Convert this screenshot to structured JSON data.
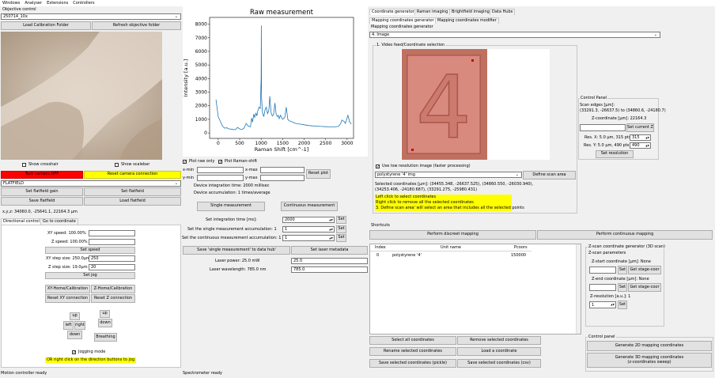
{
  "menu": [
    "Windows",
    "Analyser",
    "Extensions",
    "Controllers"
  ],
  "objective": {
    "group_label": "Objective control",
    "selected": "250714_10x",
    "load_calib": "Load Calibration Folder",
    "refresh": "Refresh objective folder",
    "show_crosshair": "Show crosshair",
    "show_scalebar": "Show scalebar",
    "turn_camera_off": "Turn camera OFF",
    "reset_camera": "Reset camera connection",
    "flatfield_select": "FLATFIELD",
    "set_flatfield_gain": "Set flatfield gain",
    "set_flatfield": "Set flatfield",
    "save_flatfield": "Save flatfield",
    "load_flatfield": "Load flatfield",
    "coords": "x,y,z: 34060.0, -25641.1, 22164.3 µm"
  },
  "motion": {
    "tab_directional": "Directional control",
    "tab_goto": "Go to coordinate",
    "xy_speed_label": "XY speed: 100.00%",
    "z_speed_label": "Z speed: 100.00%",
    "set_speed": "Set speed",
    "xy_step_label": "XY step size: 250.0µm",
    "xy_step_value": "250",
    "z_step_label": "Z step size: 19.0µm",
    "z_step_value": "20",
    "set_jog": "Set jog",
    "xy_home": "XY-Home/Calibration",
    "z_home": "Z-Home/Calibration",
    "reset_xy": "Reset XY connection",
    "reset_z": "Reset Z connection",
    "up": "up",
    "left": "left",
    "right": "right",
    "down": "down",
    "z_up": "up",
    "z_down": "down",
    "breathing": "Breathing",
    "jogging_mode": "Jogging mode",
    "hint": "OR right click on the direction buttons to jog",
    "status": "Motion controller ready"
  },
  "spectro": {
    "chart_title": "Raw measurement",
    "plot_raw_only": "Plot raw only",
    "plot_raman_shift": "Plot Raman-shift",
    "x_min": "x-min",
    "x_max": "x-max",
    "y_min": "y-min",
    "y_max": "y-max",
    "reset_plot": "Reset plot",
    "integration_time": "Device integration time: 2000 millisec",
    "accumulation": "Device accumulation: 1 times/average",
    "single_measurement": "Single measurement",
    "continuous_measurement": "Continuous measurement",
    "set_int_label": "Set integration time [ms]:",
    "set_int_value": "2000",
    "set_single_acc_label": "Set the single measurement accumulation: 1",
    "set_single_acc_value": "1",
    "set_cont_acc_label": "Set the continuous measurement accumulation: 1",
    "set_cont_acc_value": "1",
    "set": "Set",
    "save_single": "Save 'single measurement' to data hub'",
    "set_laser_meta": "Set laser metadata",
    "laser_power_label": "Laser power: 25.0 mW",
    "laser_power_value": "25.0",
    "laser_wl_label": "Laser wavelength: 785.0 nm",
    "laser_wl_value": "785.0",
    "status": "Spectrometer ready"
  },
  "chart_data": {
    "type": "line",
    "title": "Raw measurement",
    "xlabel": "Raman Shift [cm^-1]",
    "ylabel": "Intensity [a.u.]",
    "xlim": [
      -200,
      3150
    ],
    "ylim": [
      -400,
      8500
    ],
    "xticks": [
      0,
      500,
      1000,
      1500,
      2000,
      2500,
      3000
    ],
    "yticks": [
      0,
      1000,
      2000,
      3000,
      4000,
      5000,
      6000,
      7000,
      8000
    ],
    "series": [
      {
        "x": [
          -50,
          0,
          100,
          150,
          200,
          250,
          300,
          350,
          400,
          450,
          500,
          550,
          600,
          650,
          700,
          750,
          780,
          800,
          830,
          850,
          880,
          900,
          920,
          950,
          980,
          1000,
          1003,
          1010,
          1030,
          1060,
          1090,
          1120,
          1150,
          1180,
          1200,
          1230,
          1260,
          1290,
          1320,
          1350,
          1380,
          1400,
          1420,
          1450,
          1480,
          1500,
          1550,
          1583,
          1600,
          1620,
          1650,
          1700,
          1800,
          1900,
          2000,
          2100,
          2200,
          2300,
          2400,
          2500,
          2600,
          2700,
          2800,
          2850,
          2880,
          2900,
          2930,
          2960,
          2990,
          3020,
          3060,
          3100
        ],
        "y": [
          2450,
          1200,
          500,
          350,
          380,
          300,
          280,
          250,
          240,
          400,
          300,
          260,
          350,
          700,
          500,
          450,
          1100,
          800,
          1400,
          1150,
          1450,
          1250,
          1600,
          1900,
          1800,
          4100,
          7900,
          2600,
          1500,
          1200,
          1700,
          1900,
          1400,
          1700,
          2700,
          1500,
          1250,
          1350,
          2200,
          1350,
          1200,
          1300,
          1050,
          1300,
          1100,
          1000,
          1150,
          1900,
          1500,
          1000,
          900,
          850,
          700,
          650,
          600,
          550,
          520,
          500,
          480,
          460,
          450,
          450,
          480,
          700,
          950,
          900,
          850,
          700,
          1000,
          1300,
          800,
          650
        ]
      }
    ]
  },
  "coord_gen": {
    "tabs": [
      "Coordinate generator",
      "Raman imaging",
      "Brightfield imaging",
      "Data Hubs"
    ],
    "subtabs": [
      "Mapping coordinates generator",
      "Mapping coordinates modifier"
    ],
    "group_label": "Mapping coordinates generator",
    "method_selected": "4. Image",
    "video_group": "1. Video feed/Coordinate selection",
    "low_res": "Use low resolution image (faster processing)",
    "image_select": "polystyrene '4' img",
    "define_scan": "Define scan area",
    "selected_coords": "Selected coordinates [µm]: (34455.348, -26637.525), (34860.550, -26030.940),",
    "selected_coords2": "(34253.406, -24180.687), (33291.275, -25980.431)",
    "hint1": "Left click to select coordinates",
    "hint2": "Right click to remove all the selected coordinates",
    "hint3": "3. Define scan area' will select an area that includes all the selected points",
    "cp_label": "Control Panel",
    "scan_edges_title": "Scan edges [µm]:",
    "scan_edges_val": "(33291.3, -26637.5) to (34860.6, -24180.7)",
    "z_coord_label": "Z-coordinate [µm]: 22164.3",
    "set_current_z": "Set current Z",
    "res_x_label": "Res. X: 5.0 µm, 315 pts",
    "res_x_value": "315",
    "res_y_label": "Res. Y: 5.0 µm, 490 pts",
    "res_y_value": "490",
    "set_resolution": "Set resolution",
    "image_digit": "4"
  },
  "shortcuts": {
    "label": "Shortcuts",
    "discrete": "Perform discreet mapping",
    "continuous": "Perform continuous mapping"
  },
  "table": {
    "headers": [
      "Index",
      "Unit name",
      "Pcoors"
    ],
    "rows": [
      [
        "0",
        "polystyrene '4'",
        "150000"
      ]
    ]
  },
  "list_buttons": {
    "select_all": "Select all coordinates",
    "remove_selected": "Remove selected coordinates",
    "rename": "Rename selected coordinates",
    "load": "Load a coordinate",
    "save_pickle": "Save selected coordinates (pickle)",
    "save_csv": "Save selected coordinates (csv)"
  },
  "zscan": {
    "label": "Z-scan coordinate generator (3D scan)",
    "params": "Z-scan parameters",
    "start_label": "Z-start coordinate [µm]: None",
    "end_label": "Z-end coordinate [µm]: None",
    "set": "Set",
    "get_stage": "Get stage-coor",
    "res_label": "Z-resolution [a.u.]: 1",
    "res_value": "1"
  },
  "panel": {
    "label": "Control panel",
    "gen2d": "Generate 2D mapping coordinates",
    "gen3d_line1": "Generate 3D mapping coordinates",
    "gen3d_line2": "(z-coordinates sweep)"
  }
}
